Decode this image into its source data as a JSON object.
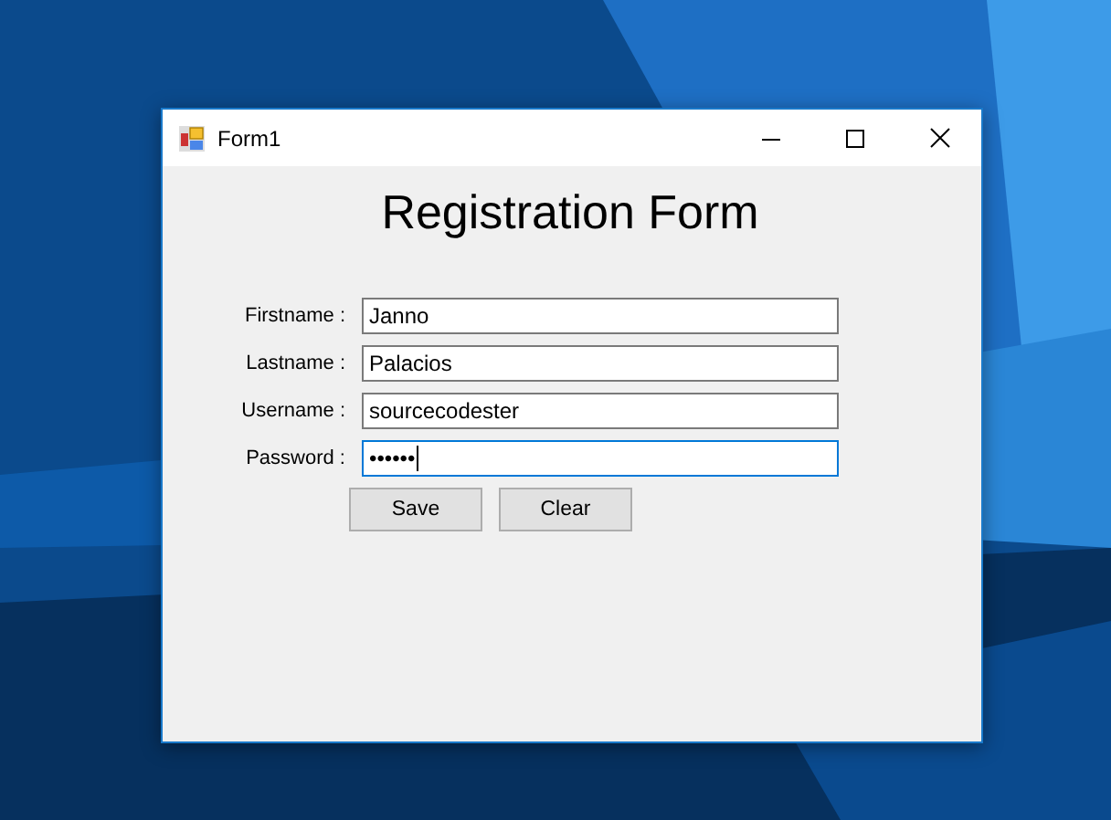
{
  "window": {
    "title": "Form1"
  },
  "heading": "Registration Form",
  "fields": [
    {
      "label": "Firstname :",
      "value": "Janno",
      "focused": false
    },
    {
      "label": "Lastname :",
      "value": "Palacios",
      "focused": false
    },
    {
      "label": "Username :",
      "value": "sourcecodester",
      "focused": false
    },
    {
      "label": "Password :",
      "value": "••••••",
      "focused": true
    }
  ],
  "buttons": [
    "Save",
    "Clear"
  ]
}
